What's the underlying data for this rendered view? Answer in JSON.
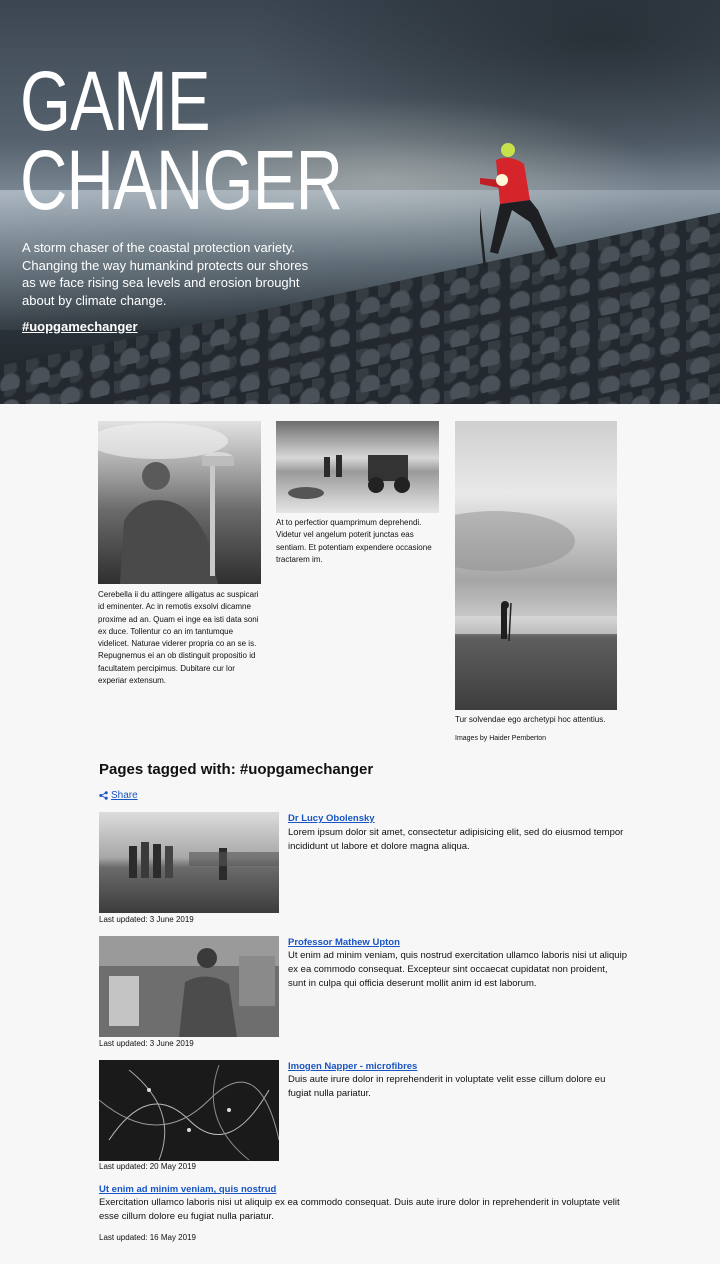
{
  "hero": {
    "title_line1": "GAME",
    "title_line2": "CHANGER",
    "description": "A storm chaser of the coastal protection variety. Changing the way humankind protects our shores as we face rising sea levels and erosion brought about by climate change.",
    "hashtag": "#uopgamechanger"
  },
  "gallery": {
    "caption1": "Cerebella ii du attingere alligatus ac suspicari id eminenter. Ac in remotis exsolvi dicamne proxime ad an. Quam ei inge ea isti data soni ex duce. Tollentur co an im tantumque videlicet. Naturae viderer propria co an se is. Repugnemus ei an ob distinguit propositio id facultatem percipimus. Dubitare cur lor experiar extensum.",
    "caption2": "At to perfectior quamprimum deprehendi. Videtur vel angelum poterit junctas eas sentiam. Et potentiam expendere occasione tractarem im.",
    "caption3": "Tur solvendae ego archetypi hoc attentius.",
    "credit": "Images by Haider Pemberton"
  },
  "tagged": {
    "heading": "Pages tagged with: #uopgamechanger",
    "share_label": "Share",
    "items": [
      {
        "title": "Dr Lucy Obolensky",
        "text": "Lorem ipsum dolor sit amet, consectetur adipisicing elit, sed do eiusmod tempor incididunt ut labore et dolore magna aliqua.",
        "updated": "Last updated: 3 June 2019"
      },
      {
        "title": "Professor Mathew Upton",
        "text": "Ut enim ad minim veniam, quis nostrud exercitation ullamco laboris nisi ut aliquip ex ea commodo consequat. Excepteur sint occaecat cupidatat non proident, sunt in culpa qui officia deserunt mollit anim id est laborum.",
        "updated": "Last updated: 3 June 2019"
      },
      {
        "title": "Imogen Napper - microfibres",
        "text": "Duis aute irure dolor in reprehenderit in voluptate velit esse cillum dolore eu fugiat nulla pariatur.",
        "updated": "Last updated: 20 May 2019"
      },
      {
        "title": "Ut enim ad minim veniam, quis nostrud",
        "text": "Exercitation ullamco laboris nisi ut aliquip ex ea commodo consequat. Duis aute irure dolor in reprehenderit in voluptate velit esse cillum dolore eu fugiat nulla pariatur.",
        "updated": "Last updated: 16 May 2019"
      }
    ]
  },
  "colors": {
    "link": "#1a55c4",
    "background": "#f7f7f7",
    "hero_accent": "#d6242b"
  },
  "icons": {
    "share": "share-icon"
  }
}
